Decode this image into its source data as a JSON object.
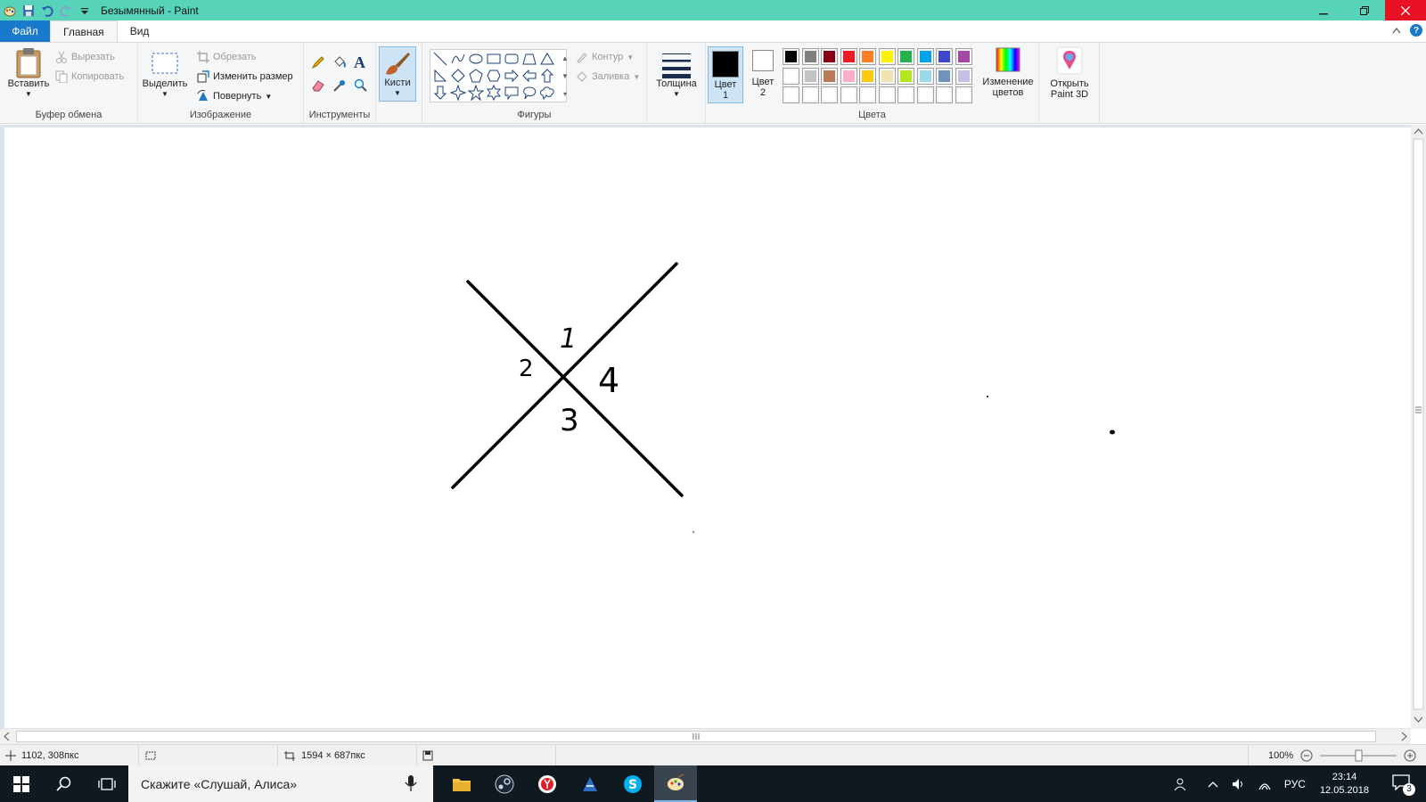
{
  "window": {
    "title": "Безымянный - Paint"
  },
  "tabs": [
    {
      "label": "Файл"
    },
    {
      "label": "Главная"
    },
    {
      "label": "Вид"
    }
  ],
  "ribbon": {
    "clipboard": {
      "paste": "Вставить",
      "cut": "Вырезать",
      "copy": "Копировать",
      "label": "Буфер обмена"
    },
    "image": {
      "select": "Выделить",
      "crop": "Обрезать",
      "resize": "Изменить размер",
      "rotate": "Повернуть",
      "label": "Изображение"
    },
    "tools": {
      "label": "Инструменты"
    },
    "brushes": {
      "label": "Кисти"
    },
    "shapes": {
      "outline": "Контур",
      "fill": "Заливка",
      "label": "Фигуры"
    },
    "size": {
      "label": "Толщина"
    },
    "colors": {
      "color1_line1": "Цвет",
      "color1_line2": "1",
      "color2_line1": "Цвет",
      "color2_line2": "2",
      "edit_line1": "Изменение",
      "edit_line2": "цветов",
      "label": "Цвета",
      "color1": "#000000",
      "color2": "#ffffff",
      "palette_row1": [
        "#000000",
        "#7f7f7f",
        "#880015",
        "#ed1c24",
        "#ff7f27",
        "#fff200",
        "#22b14c",
        "#00a2e8",
        "#3f48cc",
        "#a349a4"
      ],
      "palette_row2": [
        "#ffffff",
        "#c3c3c3",
        "#b97a57",
        "#ffaec9",
        "#ffc90e",
        "#efe4b0",
        "#b5e61d",
        "#99d9ea",
        "#7092be",
        "#c8bfe7"
      ],
      "palette_row3": [
        "#ffffff",
        "#ffffff",
        "#ffffff",
        "#ffffff",
        "#ffffff",
        "#ffffff",
        "#ffffff",
        "#ffffff",
        "#ffffff",
        "#ffffff"
      ]
    },
    "paint3d": {
      "line1": "Открыть",
      "line2": "Paint 3D"
    }
  },
  "canvas": {
    "label1": "1",
    "label2": "2",
    "label3": "3",
    "label4": "4"
  },
  "status": {
    "cursor_pos": "1102, 308пкс",
    "selection_size": "",
    "canvas_size": "1594 × 687пкс",
    "zoom": "100%"
  },
  "taskbar": {
    "search_text": "Скажите «Слушай, Алиса»",
    "language": "РУС",
    "time": "23:14",
    "date": "12.05.2018",
    "notifications": "3"
  }
}
